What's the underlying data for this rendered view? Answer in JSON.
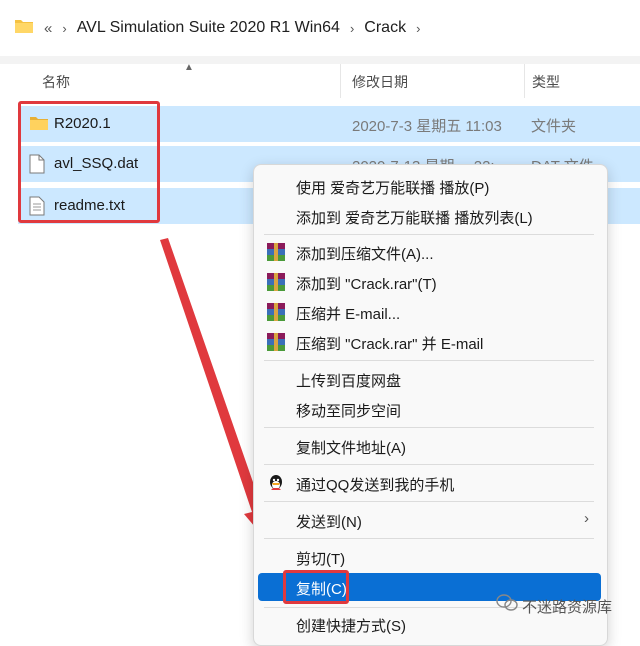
{
  "address": {
    "back_glyph": "«",
    "crumbs": [
      "AVL Simulation Suite 2020 R1 Win64",
      "Crack"
    ]
  },
  "columns": {
    "name": "名称",
    "date": "修改日期",
    "type": "类型"
  },
  "files": [
    {
      "name": "R2020.1",
      "date": "2020-7-3 星期五 11:03",
      "type": "文件夹",
      "icon": "folder-icon"
    },
    {
      "name": "avl_SSQ.dat",
      "date": "2020-7-13 星期一 22:",
      "type": "DAT 文件",
      "icon": "file-icon"
    },
    {
      "name": "readme.txt",
      "date": "",
      "type": "",
      "icon": "text-file-icon"
    }
  ],
  "context_menu": {
    "items": [
      {
        "label": "使用 爱奇艺万能联播 播放(P)",
        "icon": ""
      },
      {
        "label": "添加到 爱奇艺万能联播 播放列表(L)",
        "icon": ""
      },
      {
        "label": "添加到压缩文件(A)...",
        "icon": "winrar-icon"
      },
      {
        "label": "添加到 \"Crack.rar\"(T)",
        "icon": "winrar-icon"
      },
      {
        "label": "压缩并 E-mail...",
        "icon": "winrar-icon"
      },
      {
        "label": "压缩到 \"Crack.rar\" 并 E-mail",
        "icon": "winrar-icon"
      },
      {
        "label": "上传到百度网盘",
        "icon": ""
      },
      {
        "label": "移动至同步空间",
        "icon": ""
      },
      {
        "label": "复制文件地址(A)",
        "icon": ""
      },
      {
        "label": "通过QQ发送到我的手机",
        "icon": "qq-icon"
      },
      {
        "label": "发送到(N)",
        "icon": "",
        "submenu": "›"
      },
      {
        "label": "剪切(T)",
        "icon": ""
      },
      {
        "label": "复制(C)",
        "icon": "",
        "selected": true
      },
      {
        "label": "创建快捷方式(S)",
        "icon": ""
      }
    ]
  },
  "watermark": "不迷路资源库",
  "colors": {
    "selection": "#cce8ff",
    "highlight": "#0a6fd4",
    "annotation": "#e0393e"
  }
}
